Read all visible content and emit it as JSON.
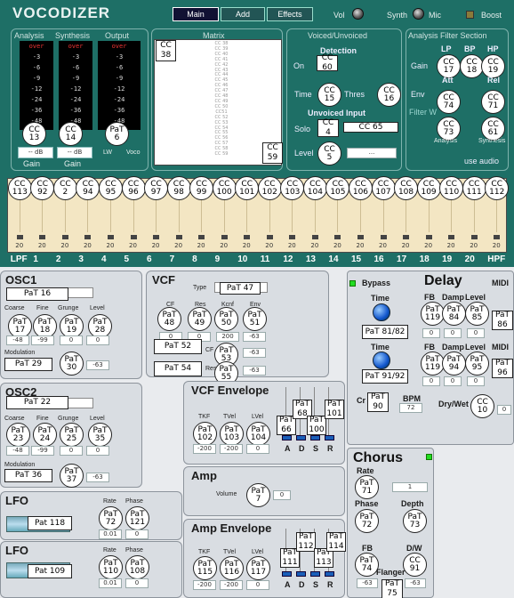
{
  "header": {
    "title": "VOCODIZER",
    "tabs": [
      "Main",
      "Add",
      "Effects"
    ],
    "vol": "Vol",
    "synth": "Synth",
    "mic": "Mic",
    "boost": "Boost"
  },
  "meters": {
    "labels": [
      "Analysis",
      "Synthesis",
      "Output"
    ],
    "scale": [
      "over",
      "-3",
      "-6",
      "-9",
      "-12",
      "-24",
      "-36",
      "-48",
      "-96"
    ],
    "cc": [
      "CC\n13",
      "CC\n14",
      "PaT\n6"
    ],
    "gain_boxes": [
      "-- dB",
      "-- dB"
    ],
    "gain_labels": [
      "Gain",
      "Gain"
    ],
    "lw": "LW",
    "voco": "Voco"
  },
  "matrix": {
    "title": "Matrix",
    "cc_top": "CC\n38",
    "cc_bottom": "CC\n59",
    "items": [
      "CC 38",
      "CC 39",
      "CC 40",
      "CC 41",
      "CC 42",
      "CC 43",
      "CC 44",
      "CC 45",
      "CC 46",
      "CC 47",
      "CC 48",
      "CC 49",
      "CC 50",
      "CC51",
      "CC 52",
      "CC 53",
      "CC 54",
      "CC 55",
      "CC 56",
      "CC 57",
      "CC 58",
      "CC 59"
    ]
  },
  "voiced": {
    "title": "Voiced/Unvoiced",
    "detection": "Detection",
    "on": "On",
    "cc_on": "CC\n60",
    "time": "Time",
    "thres": "Thres",
    "cc_time": "CC\n15",
    "cc_thres": "CC\n16",
    "unvoiced": "Unvoiced Input",
    "solo": "Solo",
    "cc_solo": "CC\n4",
    "cc65": "CC 65",
    "level": "Level",
    "cc_level": "CC\n5",
    "level_box": "..."
  },
  "afs": {
    "title": "Analysis Filter Section",
    "lp": "LP",
    "bp": "BP",
    "hp": "HP",
    "gain": "Gain",
    "cc_lp": "CC\n17",
    "cc_bp": "CC\n18",
    "cc_hp": "CC\n19",
    "att": "Att",
    "rel": "Rel",
    "env": "Env",
    "cc_att": "CC\n74",
    "cc_rel": "CC\n71",
    "filter_w": "Filter W",
    "cc_an": "CC\n73",
    "cc_sy": "CC\n61",
    "analysis": "Analysis",
    "synthesis": "Synthesis",
    "logo": "use audio"
  },
  "filters": {
    "cc": [
      "CC\n113",
      "CC\n92",
      "CC\n2",
      "CC\n94",
      "CC\n95",
      "CC\n96",
      "CC\n97",
      "CC\n98",
      "CC\n99",
      "CC\n100",
      "CC\n101",
      "CC\n102",
      "CC\n103",
      "CC\n104",
      "CC\n105",
      "CC\n106",
      "CC\n107",
      "CC\n108",
      "CC\n109",
      "CC\n110",
      "CC\n111",
      "CC\n112"
    ],
    "values": [
      "20",
      "20",
      "20",
      "20",
      "20",
      "20",
      "20",
      "20",
      "20",
      "20",
      "20",
      "20",
      "20",
      "20",
      "20",
      "20",
      "20",
      "20",
      "20",
      "20",
      "20",
      "20"
    ],
    "labels": [
      "LPF",
      "1",
      "2",
      "3",
      "4",
      "5",
      "6",
      "7",
      "8",
      "9",
      "10",
      "11",
      "12",
      "13",
      "14",
      "15",
      "16",
      "17",
      "18",
      "19",
      "20",
      "HPF"
    ]
  },
  "osc1": {
    "title": "OSC1",
    "pat": "PaT 16",
    "coarse": "Coarse",
    "fine": "Fine",
    "grunge": "Grunge",
    "level": "Level",
    "k": [
      "PaT\n17",
      "PaT\n18",
      "PaT\n19",
      "PaT\n28"
    ],
    "v": [
      "-48",
      "-99",
      "0",
      "0"
    ],
    "modulation": "Modulation",
    "mod_pat": "PaT 29",
    "mod_k": "PaT\n30",
    "mod_v": "-63"
  },
  "osc2": {
    "title": "OSC2",
    "pat": "PaT 22",
    "coarse": "Coarse",
    "fine": "Fine",
    "grunge": "Grunge",
    "level": "Level",
    "k": [
      "PaT\n23",
      "PaT\n24",
      "PaT\n25",
      "PaT\n35"
    ],
    "v": [
      "-48",
      "-99",
      "0",
      "0"
    ],
    "modulation": "Modulation",
    "mod_pat": "PaT 36",
    "mod_k": "PaT\n37",
    "mod_v": "-63"
  },
  "vcf": {
    "title": "VCF",
    "type": "Type",
    "pat47": "PaT 47",
    "k": [
      "PaT\n48",
      "PaT\n49",
      "PaT\n50",
      "PaT\n51"
    ],
    "hdr": [
      "CF",
      "Res",
      "Kcnf",
      "Env"
    ],
    "v": [
      "0",
      "0",
      "200",
      "-63"
    ],
    "pat52": "PaT 52",
    "cf": "CF",
    "k53": "PaT\n53",
    "v53": "-63",
    "pat54": "PaT 54",
    "res": "Res",
    "k55": "PaT\n55",
    "v55": "-63"
  },
  "vcfenv": {
    "title": "VCF Envelope",
    "tkf": "TKF",
    "tvel": "TVel",
    "lvel": "LVel",
    "k": [
      "PaT\n102",
      "PaT\n103",
      "PaT\n104"
    ],
    "v": [
      "-200",
      "-200",
      "0"
    ],
    "adsr": [
      "A",
      "D",
      "S",
      "R"
    ],
    "sq": [
      "PaT\n66",
      "PaT\n68",
      "PaT\n100",
      "PaT\n101"
    ]
  },
  "amp": {
    "title": "Amp",
    "volume": "Volume",
    "k": "PaT\n7",
    "v": "0"
  },
  "ampenv": {
    "title": "Amp Envelope",
    "tkf": "TKF",
    "tvel": "TVel",
    "lvel": "LVel",
    "k": [
      "PaT\n115",
      "PaT\n116",
      "PaT\n117"
    ],
    "v": [
      "-200",
      "-200",
      "0"
    ],
    "adsr": [
      "A",
      "D",
      "S",
      "R"
    ],
    "sq": [
      "PaT\n111",
      "PaT\n112",
      "PaT\n113",
      "PaT\n114"
    ]
  },
  "lfo1": {
    "title": "LFO",
    "pat": "Pat 118",
    "rate": "Rate",
    "phase": "Phase",
    "k": [
      "PaT\n72",
      "PaT\n121"
    ],
    "v": [
      "0.01",
      "0"
    ]
  },
  "lfo2": {
    "title": "LFO",
    "pat": "Pat 109",
    "rate": "Rate",
    "phase": "Phase",
    "k": [
      "PaT\n110",
      "PaT\n108"
    ],
    "v": [
      "0.01",
      "0"
    ]
  },
  "delay": {
    "title": "Delay",
    "bypass": "Bypass",
    "time": "Time",
    "pat_t1": "PaT 81/82",
    "pat_t2": "PaT 91/92",
    "fb": "FB",
    "damp": "Damp",
    "level": "Level",
    "midi": "MIDI",
    "k1": [
      "PaT\n119",
      "PaT\n84",
      "PaT\n85"
    ],
    "k2": [
      "PaT\n119",
      "PaT\n94",
      "PaT\n95"
    ],
    "m1": "PaT\n86",
    "m2": "PaT\n96",
    "v1": [
      "0",
      "0",
      "0"
    ],
    "v2": [
      "0",
      "0",
      "0"
    ],
    "cr": "Cr",
    "pat90": "PaT\n90",
    "bpm": "BPM",
    "bpm_v": "72",
    "drywet": "Dry/Wet",
    "cc10": "CC\n10",
    "dw_v": "0"
  },
  "chorus": {
    "title": "Chorus",
    "rate": "Rate",
    "k71": "PaT\n71",
    "rate_v": "1",
    "phase": "Phase",
    "k72": "PaT\n72",
    "depth": "Depth",
    "k73": "PaT\n73",
    "fb": "FB",
    "dw": "D/W",
    "k74": "PaT\n74",
    "k91": "CC\n91",
    "flanger": "Flanger",
    "k75": "PaT\n75",
    "fb_v": "-63",
    "dw_v": "-63"
  },
  "colors": {
    "top": "#1e6f66",
    "panel": "#d9dde2",
    "knob": "#1560c0"
  }
}
